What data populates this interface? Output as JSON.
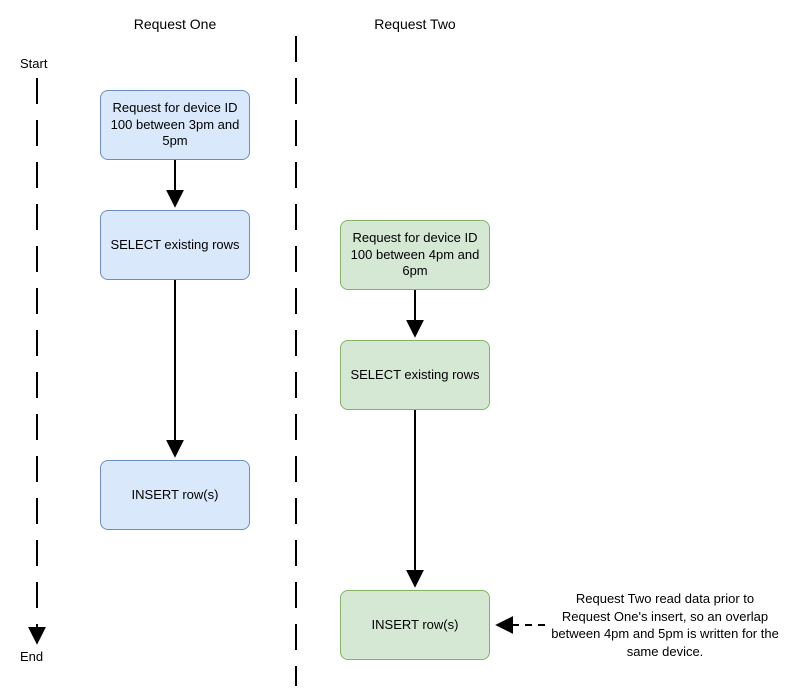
{
  "columns": {
    "left": {
      "title": "Request One"
    },
    "right": {
      "title": "Request Two"
    }
  },
  "timeline": {
    "start_label": "Start",
    "end_label": "End"
  },
  "left_lane": {
    "step1": "Request for device ID 100 between 3pm and 5pm",
    "step2": "SELECT existing rows",
    "step3": "INSERT row(s)"
  },
  "right_lane": {
    "step1": "Request for device ID 100 between 4pm and 6pm",
    "step2": "SELECT existing rows",
    "step3": "INSERT row(s)"
  },
  "annotation": "Request Two read data prior to Request One's insert, so an overlap between 4pm and 5pm is written for the same device."
}
